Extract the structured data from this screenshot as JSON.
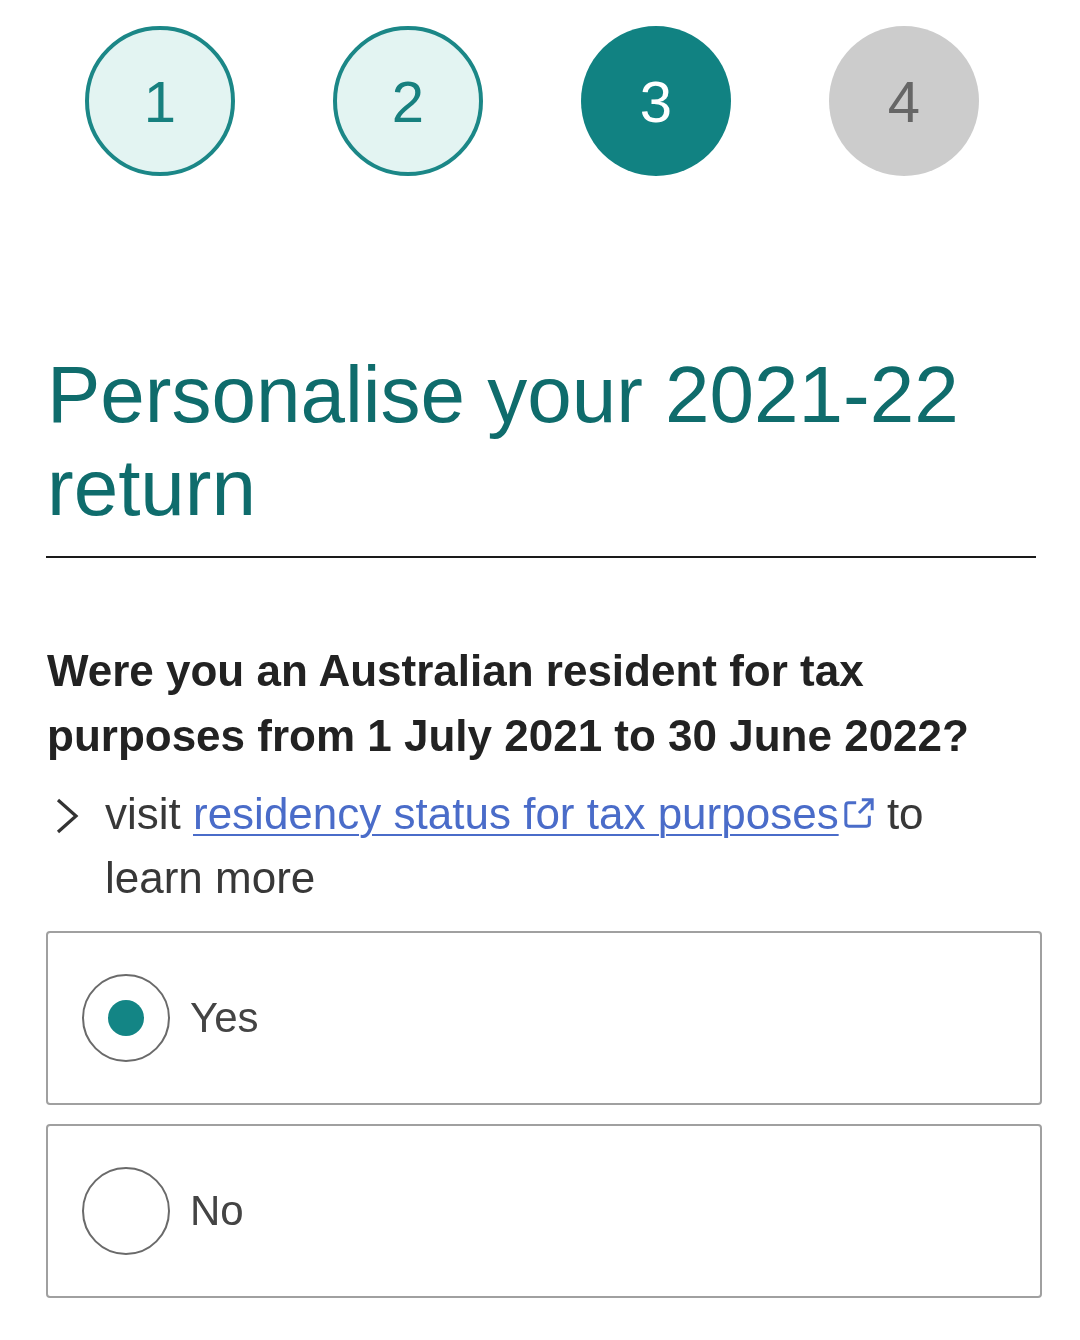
{
  "steps": [
    {
      "number": "1",
      "completed": true,
      "selected": false
    },
    {
      "number": "2",
      "completed": true,
      "selected": false
    },
    {
      "number": "3",
      "completed": false,
      "selected": true
    },
    {
      "number": "4",
      "completed": false,
      "selected": false
    }
  ],
  "heading": "Personalise your 2021-22 return",
  "question": "Were you an Australian resident for tax purposes from 1 July 2021 to 30 June 2022?",
  "help": {
    "before": "visit",
    "link": "residency status for tax purposes",
    "after": "to learn more"
  },
  "options": [
    {
      "label": "Yes",
      "selected": true
    },
    {
      "label": "No",
      "selected": false
    }
  ]
}
